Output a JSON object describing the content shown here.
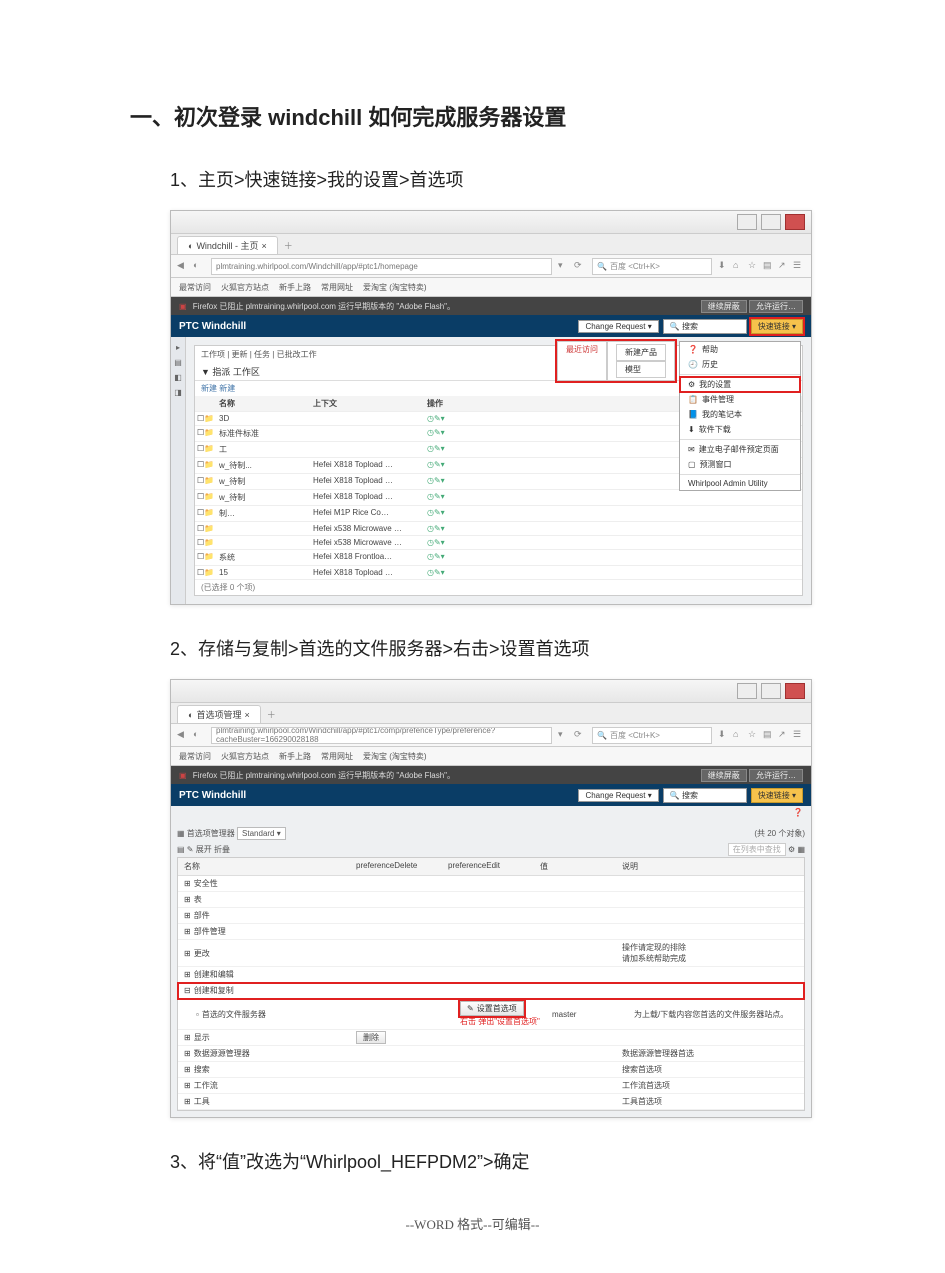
{
  "heading": "一、初次登录 windchill 如何完成服务器设置",
  "step1": "1、主页>快速链接>我的设置>首选项",
  "step2": "2、存储与复制>首选的文件服务器>右击>设置首选项",
  "step3": "3、将“值”改选为“Whirlpool_HEFPDM2”>确定",
  "footer": "--WORD 格式--可编辑--",
  "shot1": {
    "tab_title": "Windchill - 主页",
    "url": "plmtraining.whirlpool.com/Windchill/app/#ptc1/homepage",
    "search_placeholder": "百度 <Ctrl+K>",
    "bookmarks": [
      "最常访问",
      "火狐官方站点",
      "新手上路",
      "常用网址",
      "爱淘宝 (淘宝特卖)"
    ],
    "warn_text": "Firefox 已阻止 plmtraining.whirlpool.com 运行早期版本的 \"Adobe Flash\"。",
    "warn_btn1": "继续屏蔽",
    "warn_btn2": "允许运行…",
    "ptc_brand": "PTC Windchill",
    "ptc_select": "Change Request",
    "ptc_search": "搜索",
    "quicklink": "快速链接",
    "popup_labels": {
      "left": "最近访问",
      "right_top": "新建产品",
      "right_bottom": "模型"
    },
    "tabs_line": "工作项 | 更新 | 任务 | 已批改工作",
    "section_title": "▼ 指派 工作区",
    "small_btns": "新建  新建",
    "headers": {
      "c2": "名称",
      "c3": "上下文",
      "c4": "操作"
    },
    "rows": [
      {
        "name": "3D",
        "ctx": ""
      },
      {
        "name": "标准件标准",
        "ctx": ""
      },
      {
        "name": "工",
        "ctx": ""
      },
      {
        "name": "w_待制...",
        "ctx": "Hefei X818 Topload …"
      },
      {
        "name": "w_待制",
        "ctx": "Hefei X818 Topload …"
      },
      {
        "name": "w_待制",
        "ctx": "Hefei X818 Topload …"
      },
      {
        "name": "制…",
        "ctx": "Hefei M1P Rice Co…"
      },
      {
        "name": "",
        "ctx": "Hefei x538 Microwave …"
      },
      {
        "name": "",
        "ctx": "Hefei x538 Microwave …"
      },
      {
        "name": "系统",
        "ctx": "Hefei X818 Frontloa…"
      },
      {
        "name": "15",
        "ctx": "Hefei X818 Topload …"
      }
    ],
    "tfoot": "(已选择 0 个项)",
    "menu": {
      "head": "帮助",
      "recent": "历史",
      "my_settings": "我的设置",
      "profile": "事件管理",
      "notes": "我的笔记本",
      "download": "软件下载",
      "email": "建立电子邮件预定页面",
      "report": "预测窗口",
      "admin": "Whirlpool Admin Utility"
    }
  },
  "shot2": {
    "tab_title": "首选项管理",
    "url": "plmtraining.whirlpool.com/Windchill/app/#ptc1/comp/prefenceType/preference?cacheBuster=166290028188",
    "ptc_select": "Change Request",
    "section": "首选项管理器",
    "view_label": "Standard",
    "count": "(共 20 个对象)",
    "find_placeholder": "在列表中查找",
    "toolbar": "展开  折叠",
    "headers": {
      "a": "名称",
      "b": "preferenceDelete",
      "c": "preferenceEdit",
      "d": "值",
      "e": "说明"
    },
    "rows": [
      {
        "name": "安全性"
      },
      {
        "name": "表"
      },
      {
        "name": "部件"
      },
      {
        "name": "部件管理"
      },
      {
        "name": "更改",
        "desc1": "操作请定现的排除",
        "desc2": "请加系统帮助完成"
      },
      {
        "name": "创建和编辑"
      },
      {
        "name": "创建和复制",
        "hl": true
      },
      {
        "name": "首选的文件服务器",
        "indent": true,
        "action": "设置首选项",
        "note": "右击 弹出\"设置首选项\"",
        "val": "master",
        "desc": "为上载/下载内容您首选的文件服务器站点。"
      },
      {
        "name": "显示",
        "delete": "删除"
      },
      {
        "name": "数据源源管理器",
        "desc": "数据源源管理器首选"
      },
      {
        "name": "搜索",
        "desc": "搜索首选项"
      },
      {
        "name": "工作流",
        "desc": "工作流首选项"
      },
      {
        "name": "工具",
        "desc": "工具首选项"
      }
    ]
  }
}
